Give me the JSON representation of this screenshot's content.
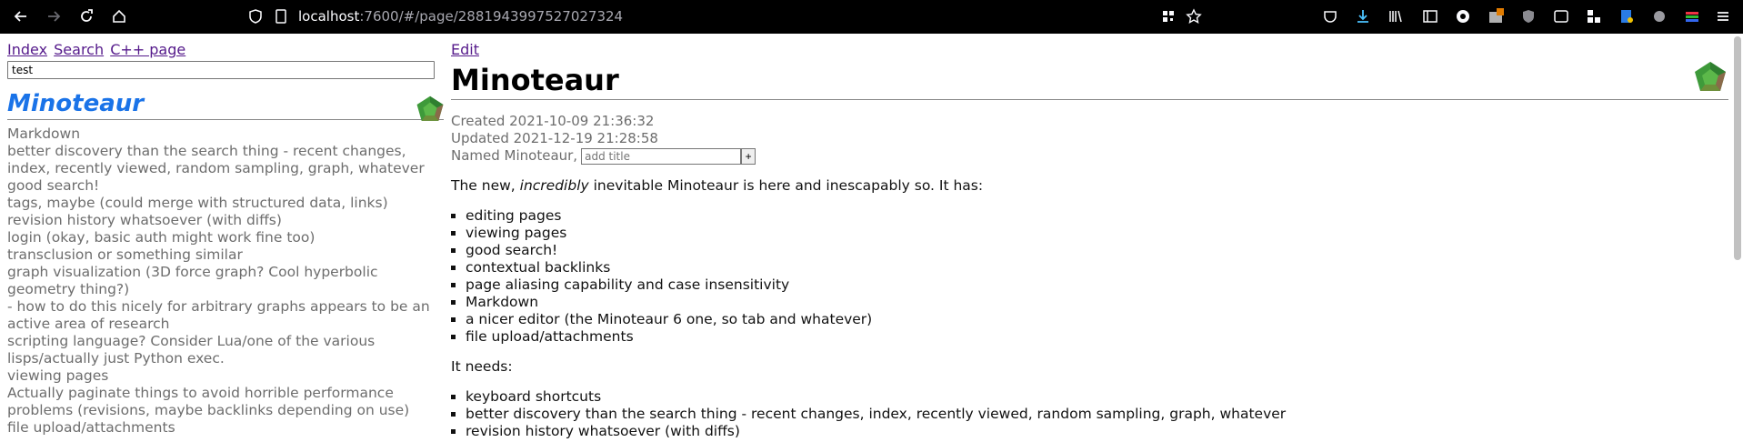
{
  "browser": {
    "url_host": "localhost",
    "url_rest": ":7600/#/page/2881943997527027324",
    "icons": [
      "back-icon",
      "forward-icon",
      "reload-icon",
      "home-icon",
      "shield-icon",
      "page-icon",
      "qr-icon",
      "star-icon",
      "pocket-icon",
      "download-icon",
      "library-icon",
      "reader-icon",
      "extension-icon",
      "menu-icon"
    ]
  },
  "sidebar": {
    "links": [
      "Index",
      "Search",
      "C++ page"
    ],
    "search_value": "test",
    "heading": "Minoteaur",
    "results": [
      "Markdown",
      "better discovery than the search thing - recent changes, index, recently viewed, random sampling, graph, whatever",
      "good search!",
      "tags, maybe (could merge with structured data, links)",
      "revision history whatsoever (with diffs)",
      "login (okay, basic auth might work fine too)",
      "transclusion or something similar",
      "graph visualization (3D force graph? Cool hyperbolic geometry thing?)",
      "- how to do this nicely for arbitrary graphs appears to be an active area of research",
      "scripting language? Consider Lua/one of the various lisps/actually just Python exec.",
      "viewing pages",
      "Actually paginate things to avoid horrible performance problems (revisions, maybe backlinks depending on use)",
      "file upload/attachments"
    ]
  },
  "page": {
    "edit_label": "Edit",
    "title": "Minoteaur",
    "created": "Created 2021-10-09 21:36:32",
    "updated": "Updated 2021-12-19 21:28:58",
    "named_label": "Named Minoteaur,",
    "add_title_placeholder": "add title",
    "add_button": "+",
    "intro_pre": "The new, ",
    "intro_em": "incredibly",
    "intro_post": " inevitable Minoteaur is here and inescapably so. It has:",
    "has_items": [
      "editing pages",
      "viewing pages",
      "good search!",
      "contextual backlinks",
      "page aliasing capability and case insensitivity",
      "Markdown",
      "a nicer editor (the Minoteaur 6 one, so tab and whatever)",
      "file upload/attachments"
    ],
    "needs_label": "It needs:",
    "needs_items": [
      "keyboard shortcuts",
      "better discovery than the search thing - recent changes, index, recently viewed, random sampling, graph, whatever",
      "revision history whatsoever (with diffs)"
    ]
  }
}
